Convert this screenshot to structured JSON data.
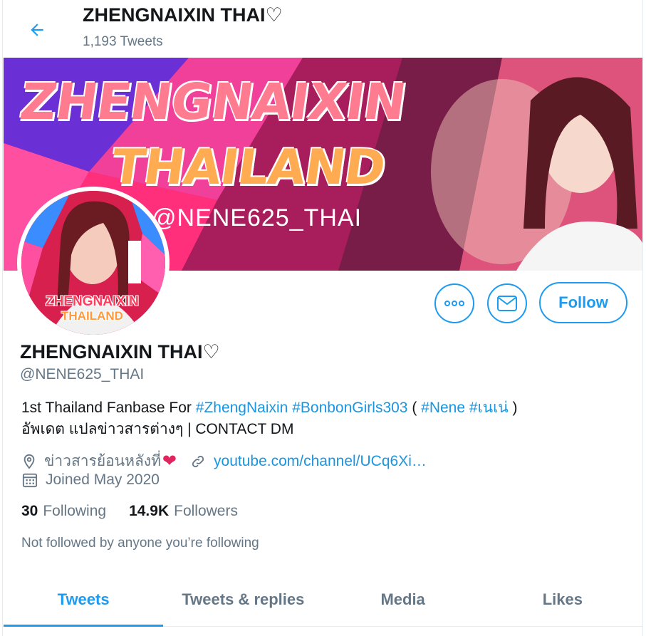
{
  "header": {
    "back_icon": "arrow-left-icon",
    "title": "ZHENGNAIXIN THAI♡",
    "tweet_count": "1,193 Tweets"
  },
  "banner": {
    "line1": "ZHENGNAIXIN",
    "line2": "THAILAND",
    "line3": "@NENE625_THAI"
  },
  "avatar": {
    "line1": "ZHENGNAIXIN",
    "line2": "THAILAND"
  },
  "actions": {
    "more_icon": "more-icon",
    "message_icon": "mail-icon",
    "follow_label": "Follow"
  },
  "profile": {
    "name": "ZHENGNAIXIN THAI♡",
    "handle": "@NENE625_THAI",
    "bio": {
      "prefix": "1st Thailand Fanbase For ",
      "tag1": "#ZhengNaixin",
      "tag2": "#BonbonGirls303",
      "paren_open": " ( ",
      "tag3": "#Nene",
      "tag4": "#เนเน่",
      "paren_close": " )",
      "line2": "อัพเดต แปลข่าวสารต่างๆ | CONTACT DM"
    },
    "location": "ข่าวสารย้อนหลังที่",
    "heart": "❤",
    "link": "youtube.com/channel/UCq6Xi…",
    "joined": "Joined May 2020",
    "following_count": "30",
    "following_label": "Following",
    "followers_count": "14.9K",
    "followers_label": "Followers",
    "not_followed": "Not followed by anyone you’re following"
  },
  "tabs": [
    {
      "label": "Tweets",
      "active": true
    },
    {
      "label": "Tweets & replies",
      "active": false
    },
    {
      "label": "Media",
      "active": false
    },
    {
      "label": "Likes",
      "active": false
    }
  ],
  "colors": {
    "accent": "#1d9bf0",
    "link": "#1b95e0",
    "secondary_text": "#657786",
    "banner_bg": "#e0285e"
  }
}
